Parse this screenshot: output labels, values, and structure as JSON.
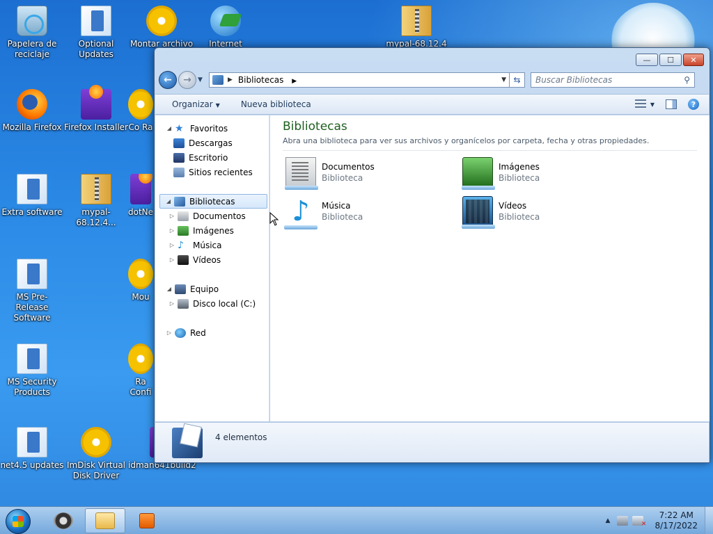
{
  "desktop": {
    "icons": [
      {
        "label": "Papelera de reciclaje",
        "icon": "recycle-bin-icon"
      },
      {
        "label": "Optional Updates",
        "icon": "folder-icon"
      },
      {
        "label": "Montar archivo in",
        "icon": "disc-icon"
      },
      {
        "label": "Internet",
        "icon": "download-manager-icon"
      },
      {
        "label": "mypal-68.12.4",
        "icon": "zip-folder-icon"
      },
      {
        "label": "Mozilla Firefox",
        "icon": "firefox-icon"
      },
      {
        "label": "Firefox Installer",
        "icon": "installer-box-icon"
      },
      {
        "label": "Co Ra",
        "icon": "app-icon"
      },
      {
        "label": "Extra software",
        "icon": "folder-icon"
      },
      {
        "label": "mypal-68.12.4...",
        "icon": "zip-folder-icon"
      },
      {
        "label": "dotNe",
        "icon": "app-icon"
      },
      {
        "label": "MS Pre-Release Software",
        "icon": "folder-icon"
      },
      {
        "label": "Mou",
        "icon": "app-icon"
      },
      {
        "label": "MS Security Products",
        "icon": "folder-icon"
      },
      {
        "label": "Ra Confi",
        "icon": "app-icon"
      },
      {
        "label": "net4.5 updates",
        "icon": "folder-icon"
      },
      {
        "label": "ImDisk Virtual Disk Driver",
        "icon": "disc-icon"
      },
      {
        "label": "idman641build2",
        "icon": "app-icon"
      }
    ]
  },
  "window": {
    "controls": {
      "minimize": "—",
      "maximize": "☐",
      "close": "✕"
    },
    "address": {
      "location": "Bibliotecas"
    },
    "search": {
      "placeholder": "Buscar Bibliotecas"
    },
    "toolbar": {
      "organize": "Organizar",
      "new_library": "Nueva biblioteca"
    },
    "nav": {
      "favorites": "Favoritos",
      "downloads": "Descargas",
      "desktop": "Escritorio",
      "recent": "Sitios recientes",
      "libraries": "Bibliotecas",
      "documents": "Documentos",
      "images": "Imágenes",
      "music": "Música",
      "videos": "Vídeos",
      "computer": "Equipo",
      "local_disk": "Disco local (C:)",
      "network": "Red"
    },
    "content": {
      "title": "Bibliotecas",
      "subtitle": "Abra una biblioteca para ver sus archivos y organícelos por carpeta, fecha y otras propiedades.",
      "libraries": [
        {
          "name": "Documentos",
          "type": "Biblioteca"
        },
        {
          "name": "Imágenes",
          "type": "Biblioteca"
        },
        {
          "name": "Música",
          "type": "Biblioteca"
        },
        {
          "name": "Vídeos",
          "type": "Biblioteca"
        }
      ]
    },
    "details": {
      "count": "4 elementos"
    }
  },
  "taskbar": {
    "clock_time": "7:22 AM",
    "clock_date": "8/17/2022"
  }
}
